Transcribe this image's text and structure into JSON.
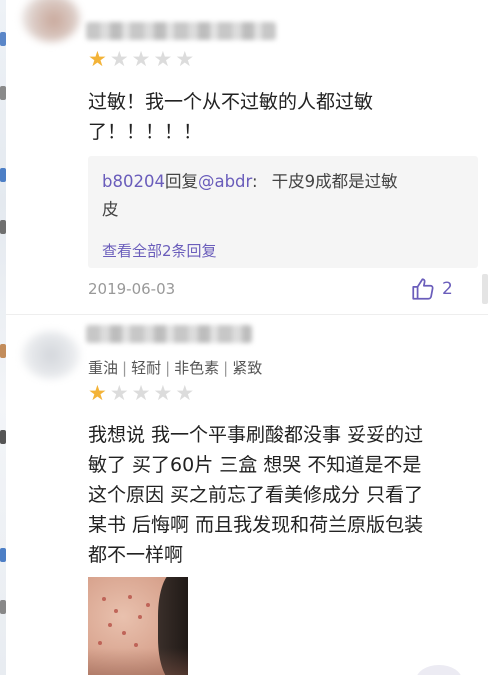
{
  "reviews": [
    {
      "rating": 1,
      "stars_total": 5,
      "text": "过敏！我一个从不过敏的人都过敏\n了！！！！！",
      "reply": {
        "user": "b80204",
        "action": "回复",
        "target": "@abdr",
        "colon": ":",
        "text": "干皮9成都是过敏\n皮",
        "view_all": "查看全部2条回复"
      },
      "date": "2019-06-03",
      "likes": "2"
    },
    {
      "tags": [
        "重油",
        "轻耐",
        "非色素",
        "紧致"
      ],
      "tag_separator": "|",
      "rating": 1,
      "stars_total": 5,
      "text": "我想说 我一个平事刷酸都没事 妥妥的过\n敏了 买了60片 三盒 想哭 不知道是不是\n这个原因 买之前忘了看美修成分 只看了\n某书 后悔啊 而且我发现和荷兰原版包装\n都不一样啊"
    }
  ],
  "icons": {
    "star": "star-icon",
    "like": "thumbs-up-icon"
  },
  "colors": {
    "star_on": "#f3b338",
    "star_off": "#dcdcdc",
    "accent": "#6a5dbb",
    "reply_bg": "#f5f5f5"
  }
}
